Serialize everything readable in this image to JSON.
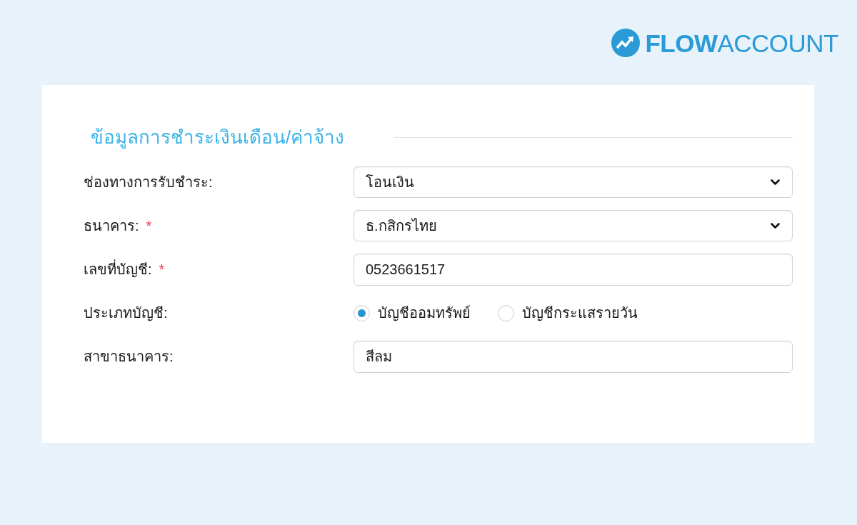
{
  "logo": {
    "wordmark": "**FLOW**ACCOUNT"
  },
  "section": {
    "title": "ข้อมูลการชำระเงินเดือน/ค่าจ้าง",
    "fields": [
      {
        "kind": "select",
        "label": "ช่องทางการรับชำระ:",
        "value": "โอนเงิน"
      },
      {
        "kind": "select",
        "label": "ธนาคาร:",
        "required_mark": "*",
        "value": "ธ.กสิกรไทย"
      },
      {
        "kind": "text",
        "label": "เลขที่บัญชี:",
        "required_mark": "*",
        "value": "0523661517"
      },
      {
        "kind": "radio",
        "label": "ประเภทบัญชี:",
        "options": [
          {
            "label": "บัญชีออมทรัพย์",
            "selected": true
          },
          {
            "label": "บัญชีกระแสรายวัน",
            "selected": false
          }
        ]
      },
      {
        "kind": "text",
        "label": "สาขาธนาคาร:",
        "value": "สีลม"
      }
    ]
  }
}
